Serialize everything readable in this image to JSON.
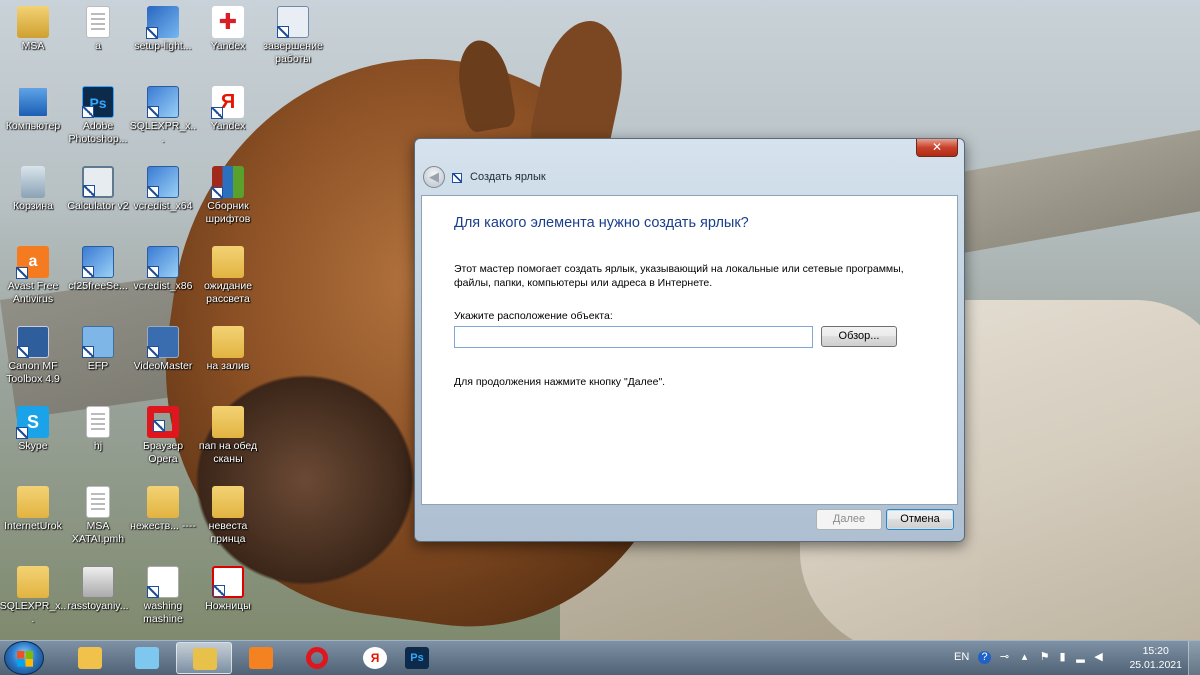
{
  "desktop": {
    "icons": [
      {
        "label": "MSA",
        "icon": "msa-icon"
      },
      {
        "label": "a",
        "icon": "document-icon"
      },
      {
        "label": "setup-light...",
        "icon": "setup-icon"
      },
      {
        "label": "Yandex",
        "icon": "yandex-gift-icon"
      },
      {
        "label": "завершение работы",
        "icon": "shutdown-icon"
      },
      {
        "label": "Компьютер",
        "icon": "computer-icon"
      },
      {
        "label": "Adobe Photoshop...",
        "icon": "photoshop-icon"
      },
      {
        "label": "SQLEXPR_x...",
        "icon": "installer-icon"
      },
      {
        "label": "Yandex",
        "icon": "yandex-icon"
      },
      {
        "label": "Корзина",
        "icon": "recycle-bin-icon"
      },
      {
        "label": "Calculator v2",
        "icon": "calculator-icon"
      },
      {
        "label": "vcredist_x64",
        "icon": "installer-icon"
      },
      {
        "label": "Сборник шрифтов",
        "icon": "archive-icon"
      },
      {
        "label": "Avast Free Antivirus",
        "icon": "avast-icon"
      },
      {
        "label": "cf25freeSe...",
        "icon": "installer-icon"
      },
      {
        "label": "vcredist_x86",
        "icon": "installer-icon"
      },
      {
        "label": "ожидание рассвета",
        "icon": "folder-icon"
      },
      {
        "label": "Canon MF Toolbox 4.9",
        "icon": "canon-icon"
      },
      {
        "label": "EFP",
        "icon": "efp-icon"
      },
      {
        "label": "VideoMaster",
        "icon": "videomaster-icon"
      },
      {
        "label": "на залив",
        "icon": "folder-icon"
      },
      {
        "label": "Skype",
        "icon": "skype-icon"
      },
      {
        "label": "hj",
        "icon": "document-icon"
      },
      {
        "label": "Браузер Opera",
        "icon": "opera-icon"
      },
      {
        "label": "пап на обед сканы",
        "icon": "folder-icon"
      },
      {
        "label": "InternetUrok",
        "icon": "folder-icon"
      },
      {
        "label": "MSA XATAI.pmh",
        "icon": "document-icon"
      },
      {
        "label": "нежеств... ----",
        "icon": "folder-icon"
      },
      {
        "label": "невеста принца",
        "icon": "folder-icon"
      },
      {
        "label": "SQLEXPR_x...",
        "icon": "folder-icon"
      },
      {
        "label": "rasstoyaniy...",
        "icon": "image-icon"
      },
      {
        "label": "washing mashine",
        "icon": "washing-icon"
      },
      {
        "label": "Ножницы",
        "icon": "scissors-icon"
      }
    ]
  },
  "dialog": {
    "title": "Создать ярлык",
    "close_label": "✕",
    "back_label": "◀",
    "heading": "Для какого элемента нужно создать ярлык?",
    "description": "Этот мастер помогает создать ярлык, указывающий на локальные или сетевые программы, файлы, папки, компьютеры или адреса в Интернете.",
    "location_label": "Укажите расположение объекта:",
    "location_value": "",
    "browse_label": "Обзор...",
    "continue_text": "Для продолжения нажмите кнопку \"Далее\".",
    "next_label": "Далее",
    "cancel_label": "Отмена"
  },
  "taskbar": {
    "pinned": [
      {
        "name": "explorer-pinned",
        "icon": "sticky-icon",
        "color": "#f0c14b"
      },
      {
        "name": "notes-pinned",
        "icon": "notes-icon",
        "color": "#7ec8f0"
      },
      {
        "name": "explorer-window",
        "icon": "folder-icon",
        "color": "#e8c14b",
        "active": true
      },
      {
        "name": "media-player",
        "icon": "media-icon",
        "color": "#f58220"
      },
      {
        "name": "opera-browser",
        "icon": "opera-icon",
        "color": "#e0161f"
      },
      {
        "name": "yandex-browser",
        "icon": "yandex-icon",
        "color": "#ffffff"
      },
      {
        "name": "photoshop-app",
        "icon": "photoshop-icon",
        "color": "#0e2a4a"
      }
    ],
    "tray": {
      "language": "EN",
      "time": "15:20",
      "date": "25.01.2021"
    }
  }
}
